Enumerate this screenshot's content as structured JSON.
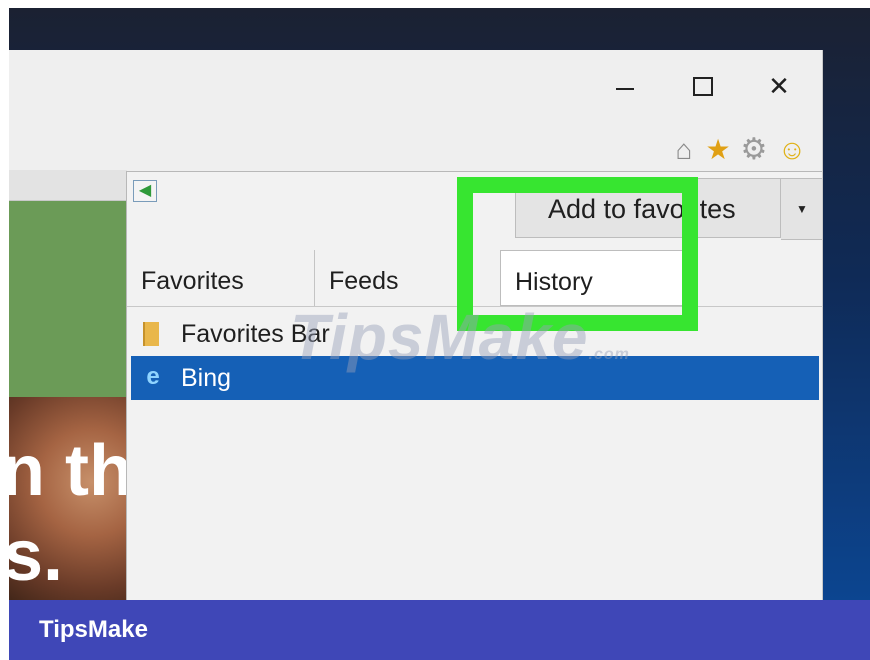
{
  "window": {
    "controls": {
      "minimize_icon": "minimize-icon",
      "maximize_icon": "maximize-icon",
      "close_glyph": "✕"
    }
  },
  "toolbar": {
    "icons": {
      "home": "⌂",
      "favorites": "★",
      "settings": "⚙",
      "feedback": "☺"
    }
  },
  "page": {
    "text_line_1": "n th",
    "text_line_2": "s."
  },
  "favorites_panel": {
    "back_glyph": "◀",
    "add_button_label": "Add to favorites",
    "add_dropdown_glyph": "▼",
    "tabs": [
      {
        "label": "Favorites",
        "active": false
      },
      {
        "label": "Feeds",
        "active": false
      },
      {
        "label": "History",
        "active": true
      }
    ],
    "items": [
      {
        "label": "Favorites Bar",
        "icon": "folder-icon",
        "selected": false
      },
      {
        "label": "Bing",
        "icon": "ie-icon",
        "selected": true
      }
    ],
    "highlight_color": "#37e530",
    "selection_color": "#1560b6"
  },
  "watermark": {
    "text": "TipsMake",
    "suffix": ".com"
  },
  "footer": {
    "logo": "TipsMake",
    "color": "#3f47b7"
  }
}
